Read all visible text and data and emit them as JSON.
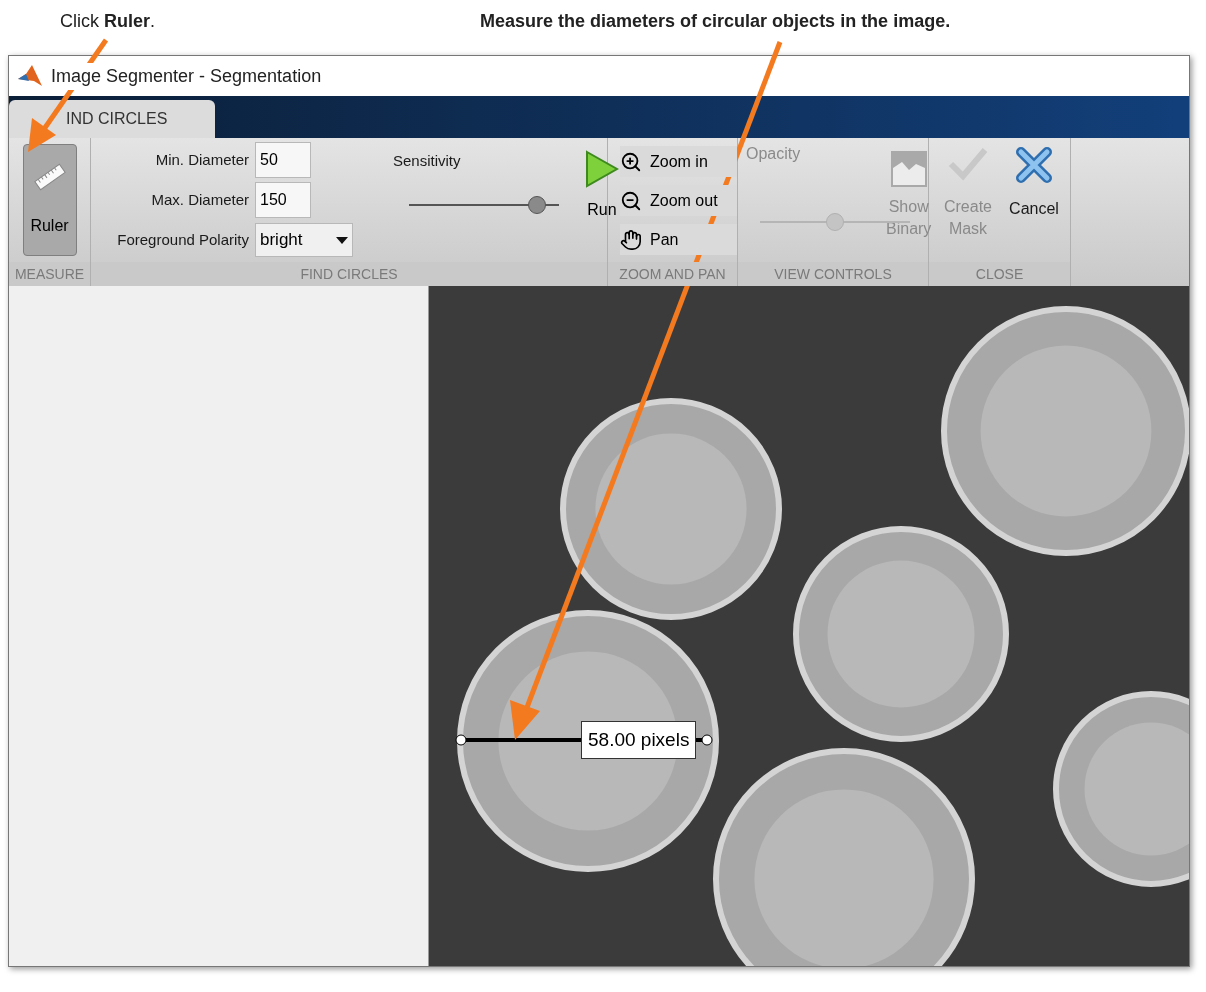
{
  "callouts": {
    "ruler": "Click **Ruler**.",
    "measure": "Measure the diameters of circular objects in the image."
  },
  "window": {
    "title": "Image Segmenter - Segmentation"
  },
  "tabs": [
    {
      "label": "IND CIRCLES",
      "selected": true
    }
  ],
  "measure": {
    "label": "MEASURE",
    "ruler": {
      "label": "Ruler",
      "selected": true
    }
  },
  "find_circles": {
    "label": "FIND CIRCLES",
    "min_diameter": {
      "label": "Min. Diameter",
      "value": "50"
    },
    "max_diameter": {
      "label": "Max. Diameter",
      "value": "150"
    },
    "foreground_polarity": {
      "label": "Foreground Polarity",
      "value": "bright"
    },
    "sensitivity": {
      "label": "Sensitivity",
      "level": 0.85
    },
    "run": {
      "label": "Run"
    }
  },
  "zoom_and_pan": {
    "label": "ZOOM AND PAN",
    "buttons": [
      {
        "label": "Zoom in",
        "kind": "zoom-in"
      },
      {
        "label": "Zoom out",
        "kind": "zoom-out"
      },
      {
        "label": "Pan",
        "kind": "pan"
      }
    ]
  },
  "view_controls": {
    "label": "VIEW CONTROLS",
    "opacity": {
      "label": "Opacity",
      "level": 0.5,
      "disabled": true
    },
    "show_binary": {
      "label": "Show Binary",
      "disabled": true
    }
  },
  "close": {
    "label": "CLOSE",
    "buttons": [
      {
        "label": "Create Mask",
        "kind": "accept",
        "disabled": true
      },
      {
        "label": "Cancel",
        "kind": "cancel",
        "disabled": false
      }
    ]
  },
  "measurement": {
    "reading": "58.00 pixels"
  }
}
